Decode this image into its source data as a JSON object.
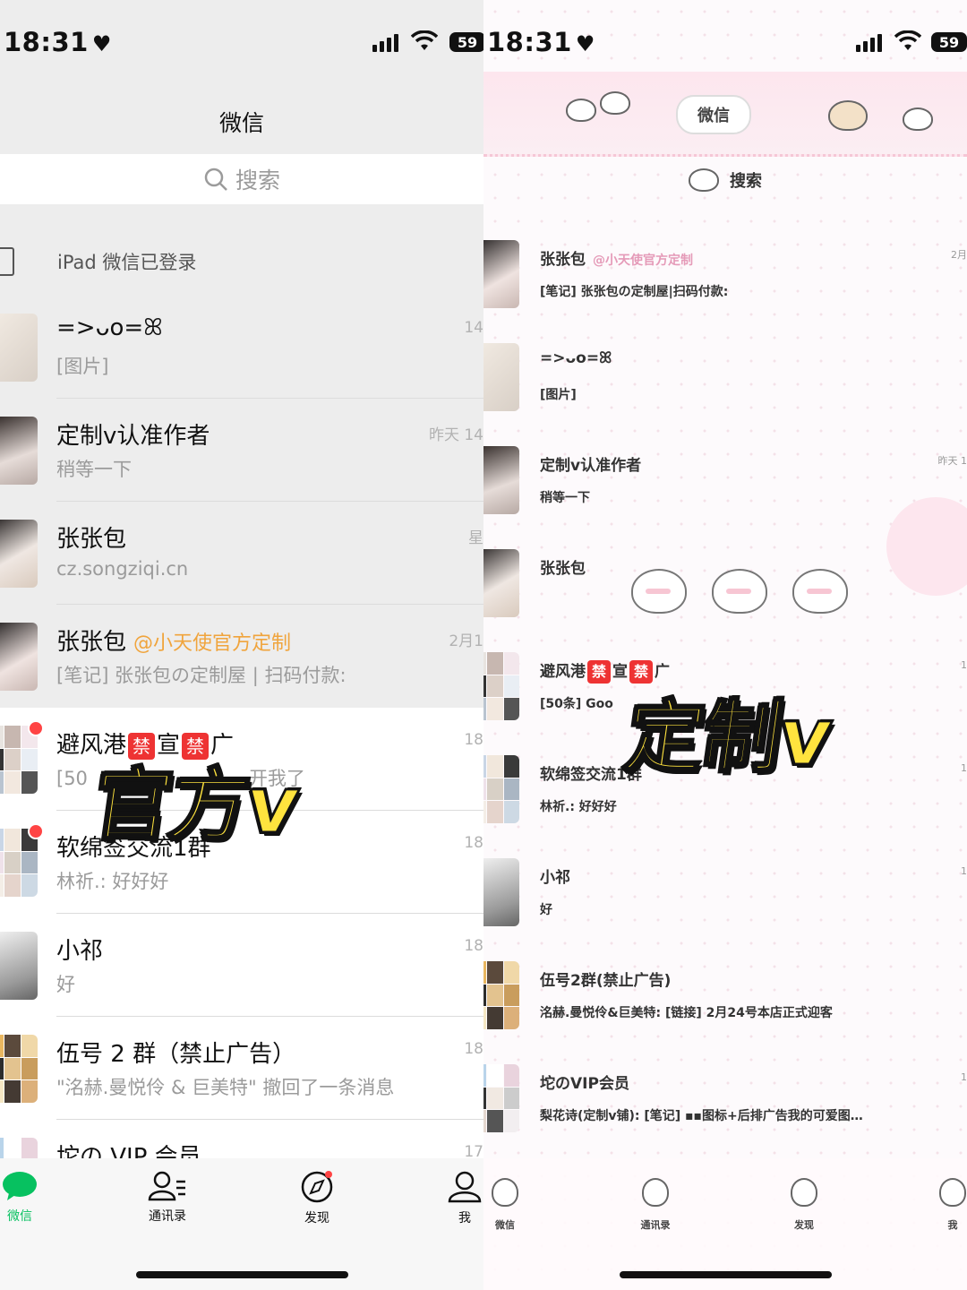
{
  "status": {
    "time": "18:31",
    "battery": "59"
  },
  "left": {
    "title": "微信",
    "search_placeholder": "搜索",
    "ipad_label": "iPad 微信已登录",
    "chats": [
      {
        "name": "=>ᴗo=ꕤ",
        "msg": "[图片]",
        "time": "14"
      },
      {
        "name": "定制v认准作者",
        "msg": "稍等一下",
        "time": "昨天 14"
      },
      {
        "name": "张张包",
        "msg": "cz.songziqi.cn",
        "time": "星"
      },
      {
        "name": "张张包",
        "at": "@小天使官方定制",
        "msg": "[笔记] 张张包の定制屋 | 扫码付款:",
        "time": "2月1"
      },
      {
        "name_a": "避风港",
        "ban": "禁",
        "name_b": "宣",
        "name_c": "广",
        "msg": "[50",
        "msg_tail": "开我了",
        "time": "18"
      },
      {
        "name": "软绵签交流1群",
        "msg": "林祈.: 好好好",
        "time": "18"
      },
      {
        "name": "小祁",
        "msg": "好",
        "time": "18"
      },
      {
        "name": "伍号 2 群（禁止广告）",
        "msg": "\"洺赫.曼悦伶 & 巨美特\" 撤回了一条消息",
        "time": "18"
      },
      {
        "name": "坨の VIP 会员",
        "msg": "",
        "time": "17"
      }
    ],
    "overlay": "官方v",
    "tabs": [
      {
        "label": "微信"
      },
      {
        "label": "通讯录"
      },
      {
        "label": "发现"
      },
      {
        "label": "我"
      }
    ]
  },
  "right": {
    "title": "微信",
    "search_placeholder": "搜索",
    "chats": [
      {
        "name": "张张包",
        "at": "@小天使官方定制",
        "msg": "[笔记] 张张包の定制屋|扫码付款:",
        "time": "2月"
      },
      {
        "name": "=>ᴗo=ꕤ",
        "msg": "[图片]",
        "time": ""
      },
      {
        "name": "定制v认准作者",
        "msg": "稍等一下",
        "time": "昨天 1"
      },
      {
        "name": "张张包",
        "msg": "",
        "time": ""
      },
      {
        "name_a": "避风港",
        "ban": "禁",
        "name_b": "宣",
        "name_c": "广",
        "msg": "[50条] Goo",
        "time": "1"
      },
      {
        "name": "软绵签交流1群",
        "msg": "林祈.: 好好好",
        "time": "1"
      },
      {
        "name": "小祁",
        "msg": "好",
        "time": "1"
      },
      {
        "name": "伍号2群(禁止广告)",
        "msg": "洺赫.曼悦伶&巨美特: [链接] 2月24号本店正式迎客",
        "time": ""
      },
      {
        "name": "坨のVIP会员",
        "msg": "梨花诗(定制v铺): [笔记] ▪▪图标+后排广告我的可爱图…",
        "time": "1"
      }
    ],
    "overlay": "定制v",
    "tabs": [
      {
        "label": "微信"
      },
      {
        "label": "通讯录"
      },
      {
        "label": "发现"
      },
      {
        "label": "我"
      }
    ]
  },
  "colors": {
    "wechat_green": "#07c160",
    "overlay_yellow": "#ffe33e",
    "mention_orange": "#f0a43c",
    "unread_red": "#ff4444"
  }
}
